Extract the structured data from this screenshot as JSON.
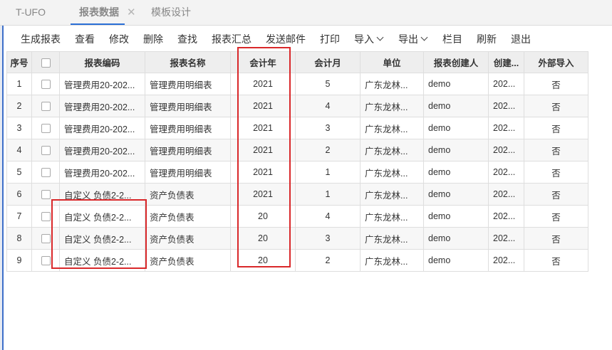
{
  "tabs": {
    "app_title": "T-UFO",
    "active_tab": "报表数据",
    "close_symbol": "✕",
    "other_tab": "模板设计"
  },
  "toolbar": {
    "generate": "生成报表",
    "view": "查看",
    "edit": "修改",
    "delete": "删除",
    "find": "查找",
    "summary": "报表汇总",
    "send_mail": "发送邮件",
    "print": "打印",
    "import": "导入",
    "export": "导出",
    "columns": "栏目",
    "refresh": "刷新",
    "exit": "退出"
  },
  "table": {
    "headers": {
      "seq": "序号",
      "code": "报表编码",
      "name": "报表名称",
      "year": "会计年",
      "month": "会计月",
      "unit": "单位",
      "creator": "报表创建人",
      "created": "创建...",
      "external": "外部导入"
    },
    "rows": [
      {
        "seq": "1",
        "code": "管理费用20-202...",
        "name": "管理费用明细表",
        "year": "2021",
        "month": "5",
        "unit": "广东龙林...",
        "creator": "demo",
        "created": "202...",
        "external": "否"
      },
      {
        "seq": "2",
        "code": "管理费用20-202...",
        "name": "管理费用明细表",
        "year": "2021",
        "month": "4",
        "unit": "广东龙林...",
        "creator": "demo",
        "created": "202...",
        "external": "否"
      },
      {
        "seq": "3",
        "code": "管理费用20-202...",
        "name": "管理费用明细表",
        "year": "2021",
        "month": "3",
        "unit": "广东龙林...",
        "creator": "demo",
        "created": "202...",
        "external": "否"
      },
      {
        "seq": "4",
        "code": "管理费用20-202...",
        "name": "管理费用明细表",
        "year": "2021",
        "month": "2",
        "unit": "广东龙林...",
        "creator": "demo",
        "created": "202...",
        "external": "否"
      },
      {
        "seq": "5",
        "code": "管理费用20-202...",
        "name": "管理费用明细表",
        "year": "2021",
        "month": "1",
        "unit": "广东龙林...",
        "creator": "demo",
        "created": "202...",
        "external": "否"
      },
      {
        "seq": "6",
        "code": "自定义 负债2-2...",
        "name": "资产负债表",
        "year": "2021",
        "month": "1",
        "unit": "广东龙林...",
        "creator": "demo",
        "created": "202...",
        "external": "否"
      },
      {
        "seq": "7",
        "code": "自定义 负债2-2...",
        "name": "资产负债表",
        "year": "20",
        "month": "4",
        "unit": "广东龙林...",
        "creator": "demo",
        "created": "202...",
        "external": "否"
      },
      {
        "seq": "8",
        "code": "自定义 负债2-2...",
        "name": "资产负债表",
        "year": "20",
        "month": "3",
        "unit": "广东龙林...",
        "creator": "demo",
        "created": "202...",
        "external": "否"
      },
      {
        "seq": "9",
        "code": "自定义 负债2-2...",
        "name": "资产负债表",
        "year": "20",
        "month": "2",
        "unit": "广东龙林...",
        "creator": "demo",
        "created": "202...",
        "external": "否"
      }
    ]
  },
  "annotation_color": "#d9282a",
  "accent_color": "#2b6fd6"
}
